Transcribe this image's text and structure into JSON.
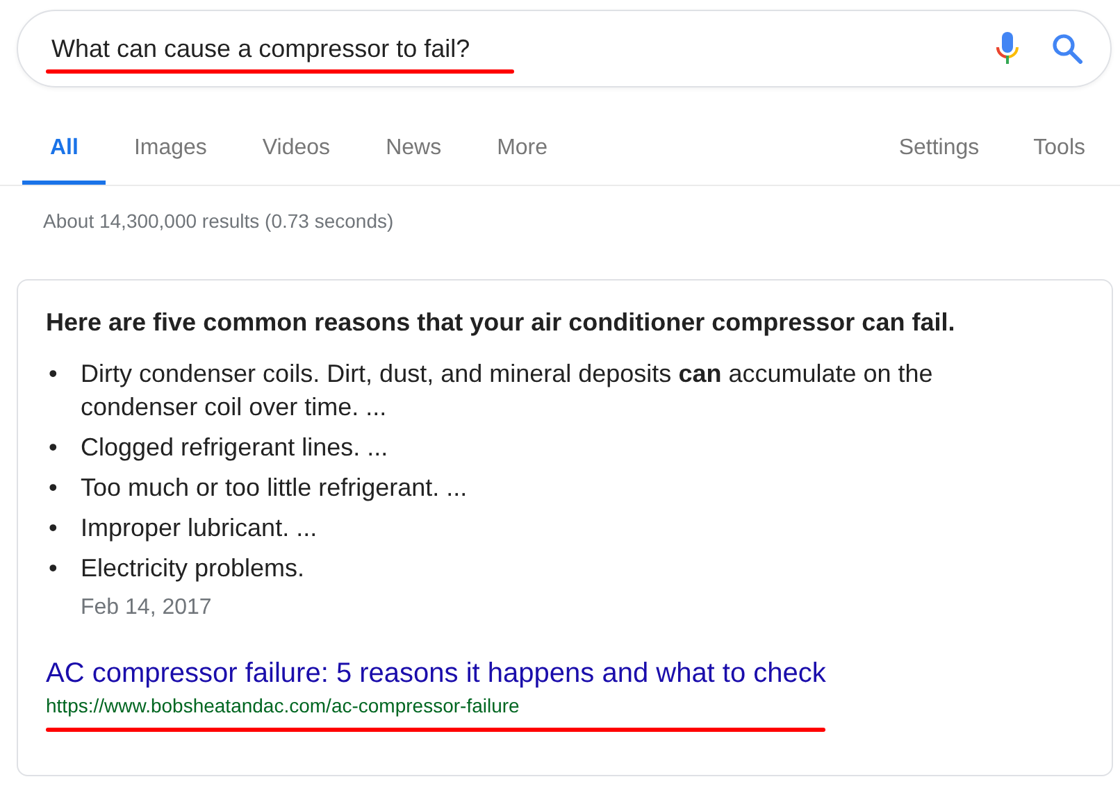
{
  "search": {
    "value": "What can cause a compressor to fail?",
    "underlined": true
  },
  "tabs": [
    {
      "label": "All",
      "selected": true
    },
    {
      "label": "Images",
      "selected": false
    },
    {
      "label": "Videos",
      "selected": false
    },
    {
      "label": "News",
      "selected": false
    },
    {
      "label": "More",
      "selected": false
    }
  ],
  "tools": [
    "Settings",
    "Tools"
  ],
  "result_stats": "About 14,300,000 results (0.73 seconds)",
  "snippet": {
    "heading": "Here are five common reasons that your air conditioner compressor can fail.",
    "items": [
      {
        "marker": "•",
        "text": "Dirty condenser coils. Dirt, dust, and mineral deposits **can** accumulate on the condenser coil over time. ..."
      },
      {
        "marker": "•",
        "text": "Clogged refrigerant lines. ..."
      },
      {
        "marker": "•",
        "text": "Too much or too little refrigerant. ..."
      },
      {
        "marker": "•",
        "text": "Improper lubricant. ..."
      },
      {
        "marker": "•",
        "text": "Electricity problems."
      }
    ],
    "date": "Feb 14, 2017",
    "title": "AC compressor failure: 5 reasons it happens and what to check",
    "url": "https://www.bobsheatandac.com/ac-compressor-failure",
    "url_underlined": true
  }
}
